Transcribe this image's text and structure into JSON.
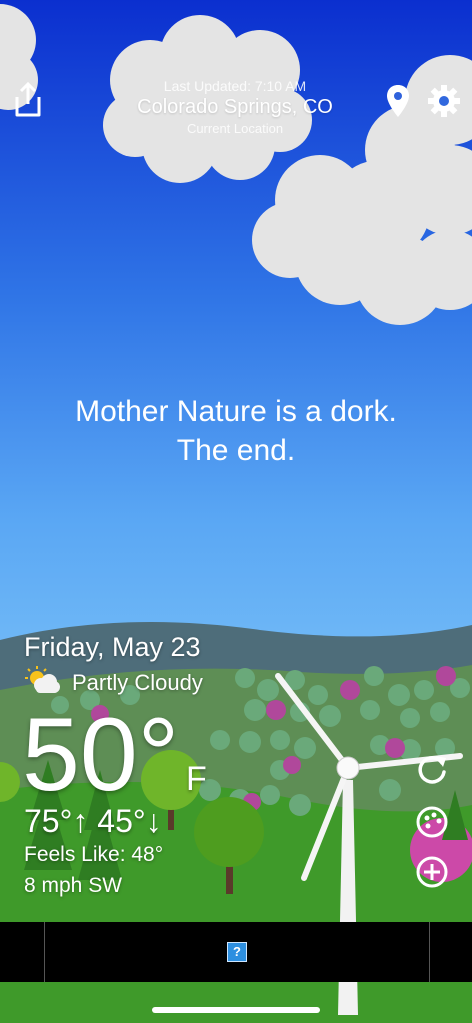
{
  "header": {
    "last_updated": "Last Updated: 7:10 AM",
    "city": "Colorado Springs, CO",
    "location_label": "Current Location"
  },
  "tagline": {
    "line1": "Mother Nature is a dork.",
    "line2": "The end."
  },
  "forecast": {
    "date": "Friday, May 23",
    "condition": "Partly Cloudy",
    "temperature": "50°",
    "unit": "F",
    "high_low": "75°↑ 45°↓",
    "feels_like": "Feels Like: 48°",
    "wind": "8 mph SW"
  },
  "ad": {
    "placeholder_glyph": "?"
  },
  "icons": {
    "share": "share-icon",
    "location": "location-pin-icon",
    "settings": "gear-icon",
    "refresh": "refresh-icon",
    "theme": "palette-icon",
    "add": "add-icon",
    "weather": "partly-cloudy-icon"
  },
  "colors": {
    "sky_top": "#0b2fcf",
    "sky_bottom": "#6fb8f6",
    "grass": "#3f9a2a",
    "ad_bar": "#000000"
  }
}
